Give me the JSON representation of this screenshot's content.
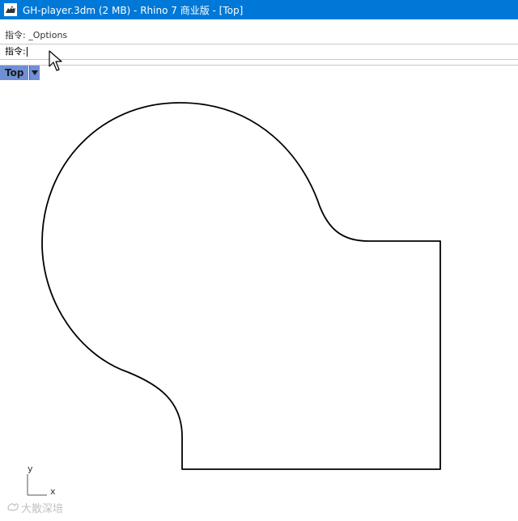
{
  "window": {
    "title": "GH-player.3dm (2 MB) - Rhino 7 商业版 - [Top]",
    "app_icon": "rhino-icon"
  },
  "command": {
    "history_text": "指令: _Options",
    "prompt_label": "指令:",
    "current_value": ""
  },
  "viewport": {
    "name": "Top",
    "menu_icon": "chevron-down-icon",
    "axis_x_label": "x",
    "axis_y_label": "y"
  },
  "watermark": {
    "text": "大散深培"
  },
  "colors": {
    "titlebar": "#0078d7",
    "tab_active": "#6f8fd6",
    "curve": "#000000"
  }
}
